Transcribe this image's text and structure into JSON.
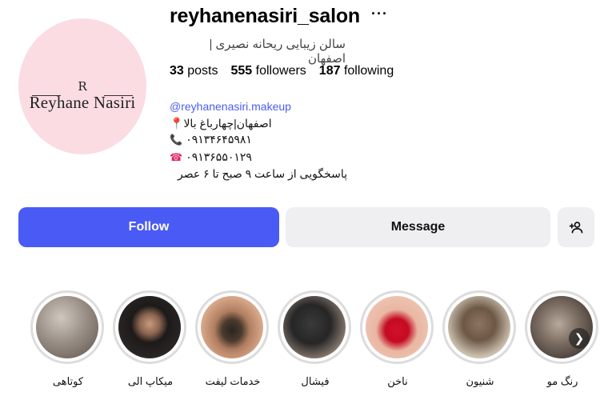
{
  "profile": {
    "username": "reyhanenasiri_salon",
    "more_icon": "more-icon",
    "full_name": "سالن زیبایی ریحانه نصیری | اصفهان",
    "avatar": {
      "monogram": "R",
      "brand": "Reyhane Nasiri"
    },
    "stats": {
      "posts_count": "33",
      "posts_label": "posts",
      "followers_count": "555",
      "followers_label": "followers",
      "following_count": "187",
      "following_label": "following"
    },
    "bio": {
      "link": "@reyhanenasiri.makeup",
      "location": "اصفهان|چهارباغ بالا",
      "location_icon": "📍",
      "mobile": "۰۹۱۳۴۶۴۵۹۸۱",
      "mobile_icon": "📞",
      "landline": "۰۹۱۳۶۵۵۰۱۲۹",
      "landline_icon": "☎",
      "hours": "پاسخگویی از ساعت ۹ صبح تا ۶ عصر"
    }
  },
  "actions": {
    "follow_label": "Follow",
    "message_label": "Message",
    "add_user_icon": "add-user-icon"
  },
  "highlights": [
    {
      "label": "کوتاهی"
    },
    {
      "label": "میکاپ الی"
    },
    {
      "label": "خدمات لیفت"
    },
    {
      "label": "فیشال"
    },
    {
      "label": "ناخن"
    },
    {
      "label": "شنیون"
    },
    {
      "label": "رنگ مو"
    }
  ],
  "colors": {
    "accent": "#4a5af5",
    "link": "#4a5df0",
    "button_secondary": "#efeff2",
    "avatar_bg": "#fbdce3"
  }
}
